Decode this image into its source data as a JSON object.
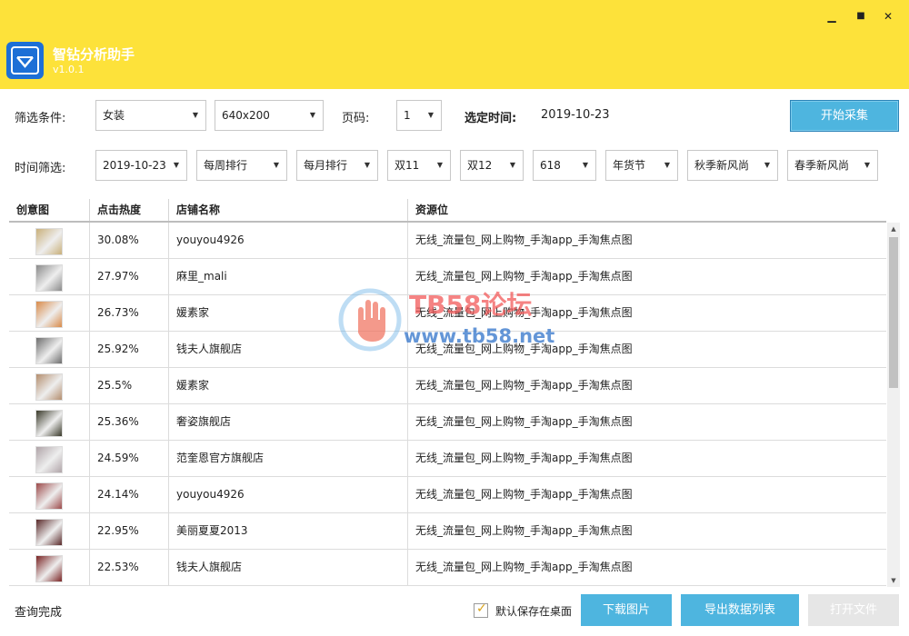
{
  "app": {
    "name": "智钻分析助手",
    "version": "v1.0.1",
    "window_buttons": {
      "minimize": "▁",
      "maximize": "■",
      "close": "✕"
    },
    "colors": {
      "titlebar": "#fde23a",
      "logo": "#1d6fd6",
      "accent_button": "#4eb5df"
    }
  },
  "filters": {
    "label": "筛选条件:",
    "category": "女装",
    "size": "640x200",
    "page_label": "页码:",
    "page": "1",
    "selected_time_label": "选定时间:",
    "selected_time": "2019-10-23",
    "start_button": "开始采集"
  },
  "time_filters": {
    "label": "时间筛选:",
    "items": [
      "2019-10-23",
      "每周排行",
      "每月排行",
      "双11",
      "双12",
      "618",
      "年货节",
      "秋季新风尚",
      "春季新风尚"
    ]
  },
  "table": {
    "columns": [
      "创意图",
      "点击热度",
      "店铺名称",
      "资源位"
    ],
    "rows": [
      {
        "heat": "30.08%",
        "shop": "youyou4926",
        "slot": "无线_流量包_网上购物_手淘app_手淘焦点图",
        "thumb": "#c9b07a"
      },
      {
        "heat": "27.97%",
        "shop": "麻里_mali",
        "slot": "无线_流量包_网上购物_手淘app_手淘焦点图",
        "thumb": "#8a8a8a"
      },
      {
        "heat": "26.73%",
        "shop": "媛素家",
        "slot": "无线_流量包_网上购物_手淘app_手淘焦点图",
        "thumb": "#d98b4a"
      },
      {
        "heat": "25.92%",
        "shop": "钱夫人旗舰店",
        "slot": "无线_流量包_网上购物_手淘app_手淘焦点图",
        "thumb": "#6d6d6d"
      },
      {
        "heat": "25.5%",
        "shop": "媛素家",
        "slot": "无线_流量包_网上购物_手淘app_手淘焦点图",
        "thumb": "#b48e6e"
      },
      {
        "heat": "25.36%",
        "shop": "奢姿旗舰店",
        "slot": "无线_流量包_网上购物_手淘app_手淘焦点图",
        "thumb": "#3a3a2a"
      },
      {
        "heat": "24.59%",
        "shop": "范奎恩官方旗舰店",
        "slot": "无线_流量包_网上购物_手淘app_手淘焦点图",
        "thumb": "#b0a4a8"
      },
      {
        "heat": "24.14%",
        "shop": "youyou4926",
        "slot": "无线_流量包_网上购物_手淘app_手淘焦点图",
        "thumb": "#9c4a4a"
      },
      {
        "heat": "22.95%",
        "shop": "美丽夏夏2013",
        "slot": "无线_流量包_网上购物_手淘app_手淘焦点图",
        "thumb": "#5a2a2a"
      },
      {
        "heat": "22.53%",
        "shop": "钱夫人旗舰店",
        "slot": "无线_流量包_网上购物_手淘app_手淘焦点图",
        "thumb": "#7a2424"
      }
    ]
  },
  "watermark": {
    "line1": "TB58论坛",
    "line2": "www.tb58.net"
  },
  "footer": {
    "status": "查询完成",
    "save_default_label": "默认保存在桌面",
    "save_default_checked": true,
    "download_button": "下载图片",
    "export_button": "导出数据列表",
    "open_file_button": "打开文件"
  }
}
